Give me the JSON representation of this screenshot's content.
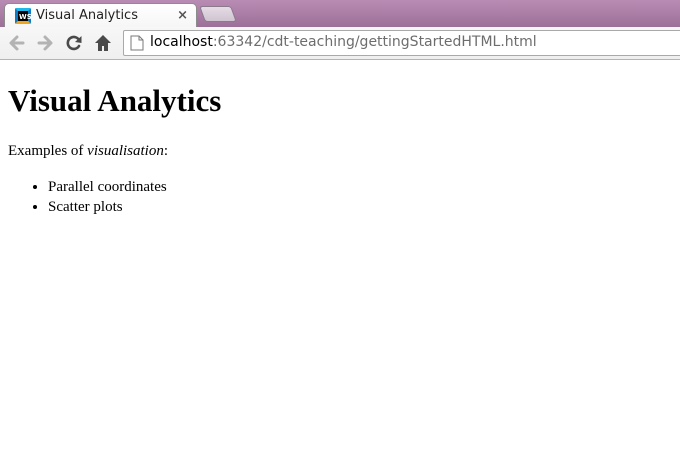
{
  "browser": {
    "tab": {
      "title": "Visual Analytics",
      "close_glyph": "×",
      "favicon": "webstorm-icon"
    },
    "toolbar": {
      "back_icon": "back-arrow-icon",
      "forward_icon": "forward-arrow-icon",
      "reload_icon": "reload-icon",
      "home_icon": "home-icon"
    },
    "address_bar": {
      "host": "localhost",
      "rest": ":63342/cdt-teaching/gettingStartedHTML.html"
    },
    "colors": {
      "frame": "#a87ba4",
      "toolbar": "#f2f2f2"
    }
  },
  "page": {
    "heading": "Visual Analytics",
    "intro_prefix": "Examples of ",
    "intro_emphasis": "visualisation",
    "intro_suffix": ":",
    "list_items": [
      "Parallel coordinates",
      "Scatter plots"
    ]
  }
}
